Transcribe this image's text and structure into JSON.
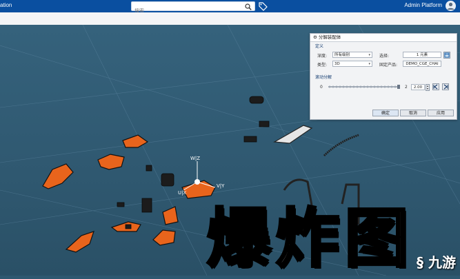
{
  "header": {
    "app_name": "ation",
    "search_placeholder": "搜索",
    "user_name": "Admin Platform"
  },
  "dialog": {
    "title": "分解装配体",
    "section_definition": "定义",
    "depth_label": "深度:",
    "depth_value": "所有级别",
    "type_label": "类型:",
    "type_value": "3D",
    "selection_label": "选择:",
    "selection_value": "1 元素",
    "fixed_product_label": "固定产品:",
    "fixed_product_value": "DEMO_CGE_CHAI",
    "section_scroll": "滚动分解",
    "slider_min": "0",
    "slider_max": "2",
    "slider_value": "2.00",
    "slider_fraction": 1.0,
    "ok_label": "确定",
    "cancel_label": "取消",
    "apply_label": "应用"
  },
  "viewport": {
    "axis_w": "W|Z",
    "axis_v": "V|Y",
    "axis_u": "U|X",
    "overlay_text": "爆炸图",
    "watermark": "九游",
    "part_color": "#e8641c"
  }
}
